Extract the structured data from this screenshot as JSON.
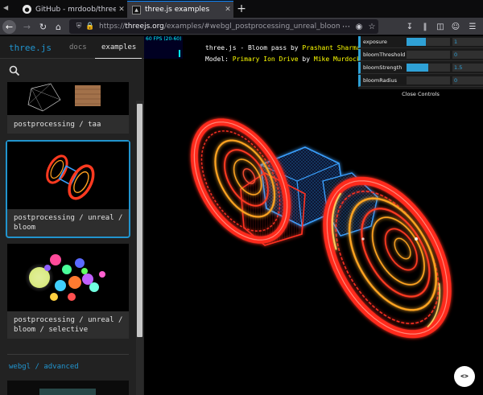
{
  "browser": {
    "tabs": [
      {
        "title": "GitHub - mrdoob/three.js: Jav",
        "favicon": "github-icon",
        "active": false
      },
      {
        "title": "three.js examples",
        "favicon": "threejs-icon",
        "active": true
      }
    ],
    "new_tab": "+",
    "url_prefix": "https://",
    "url_host": "threejs.org",
    "url_path": "/examples/#webgl_postprocessing_unreal_bloom"
  },
  "sidebar": {
    "brand": "three.js",
    "nav": [
      {
        "label": "docs"
      },
      {
        "label": "examples",
        "active": true
      }
    ],
    "cards": [
      {
        "label": "postprocessing / taa"
      },
      {
        "label": "postprocessing / unreal / bloom",
        "selected": true
      },
      {
        "label": "postprocessing / unreal / bloom / selective"
      }
    ],
    "section": "webgl / advanced"
  },
  "scene": {
    "fps": "60 FPS (20-60)",
    "info_line1_prefix": "three.js",
    "info_line1_mid": " - Bloom pass by ",
    "info_line1_author": "Prashant Sharma",
    "info_line2_prefix": "Model: ",
    "info_line2_model": "Primary Ion Drive",
    "info_line2_by": " by ",
    "info_line2_author": "Mike Murdock",
    "controls": [
      {
        "label": "exposure",
        "value": "1",
        "fraction": 0.45
      },
      {
        "label": "bloomThreshold",
        "value": "0",
        "fraction": 0.0
      },
      {
        "label": "bloomStrength",
        "value": "1.5",
        "fraction": 0.5
      },
      {
        "label": "bloomRadius",
        "value": "0",
        "fraction": 0.0
      }
    ],
    "close_controls": "Close Controls",
    "code_button": "<>"
  },
  "colors": {
    "accent": "#2194ce",
    "gui_accent": "#2fa1d6",
    "bloom_red": "#ff2a1a",
    "bloom_orange": "#ffa520",
    "bloom_blue": "#3aa0ff"
  }
}
